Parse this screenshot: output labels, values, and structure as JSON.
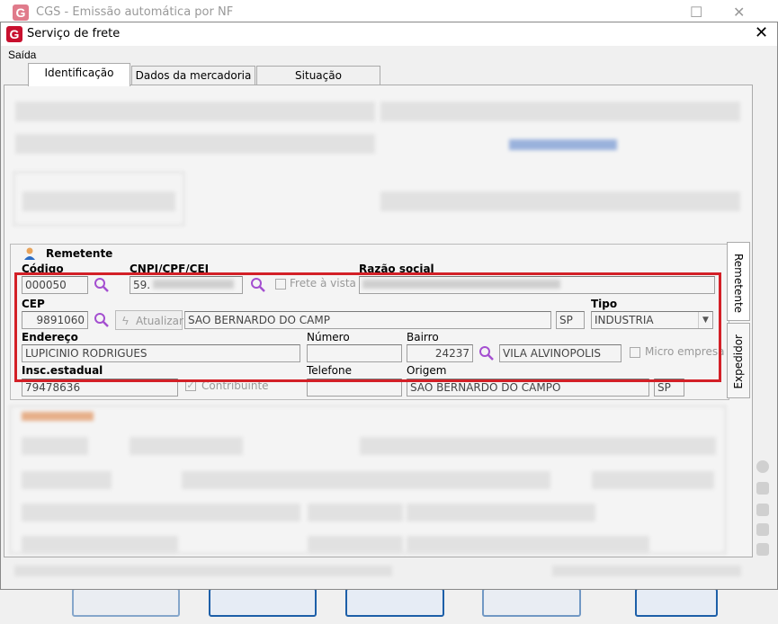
{
  "parent_window": {
    "title": "CGS - Emissão automática por NF"
  },
  "dialog": {
    "title": "Serviço de frete",
    "menu": [
      "Saída"
    ],
    "tabs": [
      {
        "label": "Identificação",
        "active": true
      },
      {
        "label": "Dados da mercadoria",
        "active": false
      },
      {
        "label": "Situação",
        "active": false
      }
    ],
    "side_tabs": [
      "Remetente",
      "Expedidor"
    ]
  },
  "remetente": {
    "title": "Remetente",
    "codigo_label": "Código",
    "codigo_value": "000050",
    "cnpj_label": "CNPJ/CPF/CEI",
    "cnpj_value": "59.",
    "frete_vista_label": "Frete à vista",
    "razao_label": "Razão social",
    "cep_label": "CEP",
    "cep_value": "9891060",
    "atualizar_label": "Atualizar",
    "cidade_value": "SAO BERNARDO DO CAMP",
    "uf_value": "SP",
    "tipo_label": "Tipo",
    "tipo_value": "INDUSTRIA",
    "endereco_label": "Endereço",
    "endereco_value": "LUPICINIO RODRIGUES",
    "numero_label": "Número",
    "numero_value": "",
    "bairro_label": "Bairro",
    "bairro_code": "24237",
    "bairro_value": "VILA ALVINOPOLIS",
    "micro_empresa_label": "Micro empresa",
    "insc_label": "Insc.estadual",
    "insc_value": "79478636",
    "contribuinte_label": "Contribuinte",
    "contribuinte_checked": true,
    "telefone_label": "Telefone",
    "telefone_value": "",
    "origem_label": "Origem",
    "origem_value": "SAO BERNARDO DO CAMPO",
    "origem_uf": "SP"
  },
  "colors": {
    "highlight": "#d32027",
    "accent": "#1d5fa8",
    "search_icon": "#a44fd0"
  }
}
